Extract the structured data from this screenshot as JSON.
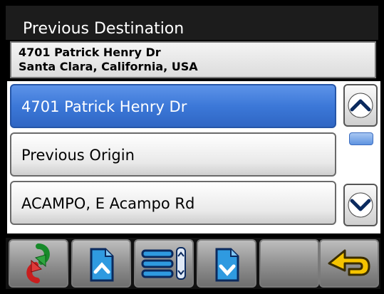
{
  "header": {
    "title": "Previous Destination"
  },
  "selected_destination": {
    "line1": "4701 Patrick Henry Dr",
    "line2": "Santa Clara, California, USA"
  },
  "list": {
    "items": [
      {
        "label": "4701 Patrick Henry Dr",
        "selected": true
      },
      {
        "label": "Previous Origin",
        "selected": false
      },
      {
        "label": "ACAMPO, E Acampo Rd",
        "selected": false
      }
    ]
  },
  "toolbar": {
    "buttons": [
      {
        "icon": "route-recalculate-icon"
      },
      {
        "icon": "page-up-icon"
      },
      {
        "icon": "list-view-icon"
      },
      {
        "icon": "page-down-icon"
      },
      {
        "icon": "empty"
      },
      {
        "icon": "back-arrow-icon"
      }
    ]
  },
  "colors": {
    "selected_item": "#3c78d8",
    "title_bg": "#1c1c1c",
    "accent_yellow": "#f5c400",
    "accent_green": "#2fa640",
    "accent_red": "#d83030"
  }
}
